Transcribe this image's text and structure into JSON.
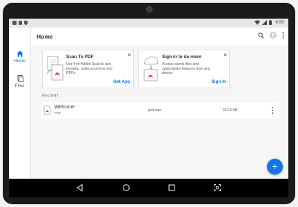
{
  "status_bar": {
    "time": "6:50",
    "icons": [
      "image-icon",
      "sim-icon",
      "shield-icon",
      "wifi-icon",
      "signal-icon",
      "battery-icon"
    ]
  },
  "nav_rail": {
    "items": [
      {
        "label": "Home",
        "icon": "home-icon",
        "active": true
      },
      {
        "label": "Files",
        "icon": "files-icon",
        "active": false
      }
    ]
  },
  "header": {
    "title": "Home",
    "icons": [
      "search-icon",
      "profile-icon",
      "more-icon"
    ]
  },
  "cards": [
    {
      "title": "Scan To PDF",
      "description": "Use free Adobe Scan to turn receipts, notes and more into PDFs.",
      "action": "Get App"
    },
    {
      "title": "Sign in to do more",
      "description": "Access saved files and subscription features from any device.",
      "action": "Sign In"
    }
  ],
  "recent": {
    "label": "RECENT",
    "files": [
      {
        "name": "Welcome",
        "type": "PDF",
        "modified": "just now",
        "size": "212.5 KB"
      }
    ]
  },
  "fab_label": "+",
  "colors": {
    "accent": "#1473e6",
    "pdf_red": "#e3311a"
  }
}
